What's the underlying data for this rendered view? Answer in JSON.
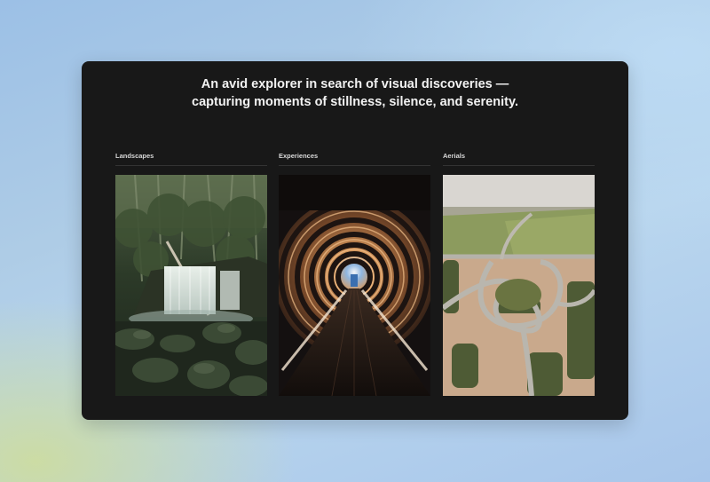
{
  "hero": {
    "line1": "An avid explorer in search of visual discoveries —",
    "line2": "capturing moments of stillness, silence, and serenity."
  },
  "categories": [
    {
      "label": "Landscapes",
      "image": "waterfall-forest-photo"
    },
    {
      "label": "Experiences",
      "image": "illuminated-tunnel-photo"
    },
    {
      "label": "Aerials",
      "image": "aerial-roundabout-photo"
    }
  ],
  "colors": {
    "card_background": "#181818",
    "headline_text": "#f2f2f2",
    "label_text": "#d8d8d8",
    "divider": "#333333"
  }
}
